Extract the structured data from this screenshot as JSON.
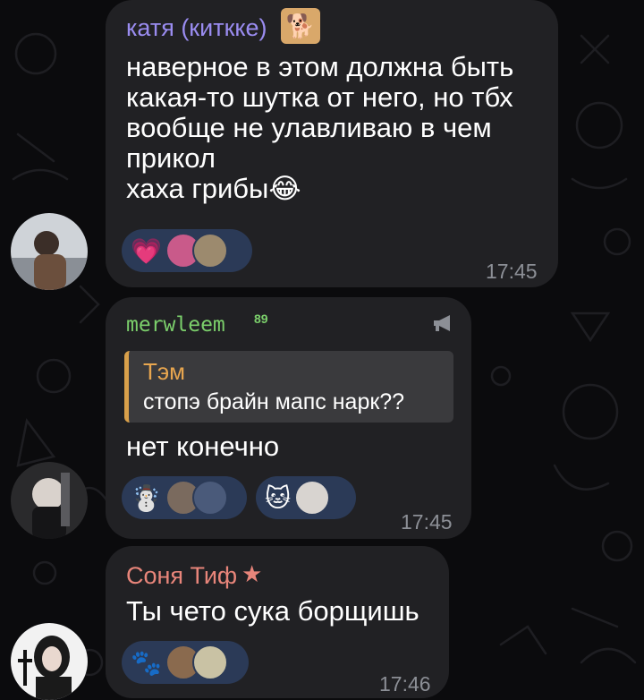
{
  "messages": [
    {
      "sender": "катя (киткке)",
      "sender_color": "#9a8cf0",
      "text": "наверное в этом должна быть какая-то шутка от него, но тбх вообще не улавливаю в чем прикол\nхаха грибы",
      "trailing_emoji": "😂",
      "time": "17:45",
      "reactions": [
        {
          "emoji": "💗"
        }
      ]
    },
    {
      "sender": "merwleem",
      "sender_badge": "89",
      "sender_color": "#7bcf6b",
      "quote": {
        "name": "Тэм",
        "text": "стопэ брайн мапс нарк??"
      },
      "text": "нет конечно",
      "time": "17:45",
      "reactions": [
        {
          "emoji": "☃️"
        },
        {
          "emoji": "🐱"
        }
      ]
    },
    {
      "sender": "Соня Тиф",
      "sender_color": "#e8857a",
      "sender_icon": "star-icon",
      "text": "Ты чето сука борщишь",
      "time": "17:46",
      "reactions": [
        {
          "emoji": "🐾"
        }
      ]
    }
  ],
  "colors": {
    "background": "#0b0b0d",
    "bubble": "#212124",
    "reaction_pill": "#2b3a57",
    "time": "#8c8f96",
    "quote_bar": "#d9a04a"
  }
}
